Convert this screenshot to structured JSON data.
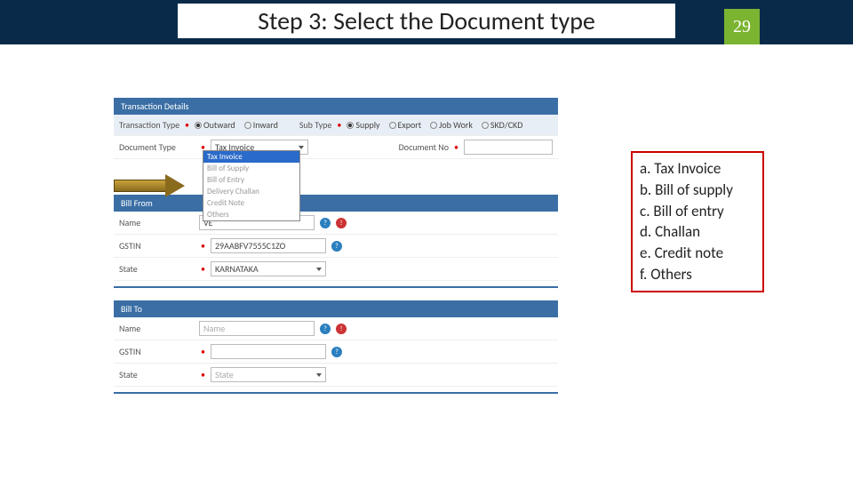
{
  "slide": {
    "title": "Step 3: Select the Document type",
    "number": "29"
  },
  "form": {
    "section_trans": "Transaction Details",
    "trans_type_label": "Transaction Type",
    "outward": "Outward",
    "inward": "Inward",
    "sub_type_label": "Sub Type",
    "supply": "Supply",
    "export": "Export",
    "jobwork": "Job Work",
    "skd": "SKD/CKD",
    "doc_type_label": "Document Type",
    "doc_type_value": "Tax Invoice",
    "doc_no_label": "Document No",
    "dropdown": {
      "o1": "Tax Invoice",
      "o2": "Bill of Supply",
      "o3": "Bill of Entry",
      "o4": "Delivery Challan",
      "o5": "Credit Note",
      "o6": "Others"
    },
    "section_from": "Bill From",
    "section_to": "Bill To",
    "name_label": "Name",
    "name_from_value": "VE",
    "gstin_label": "GSTIN",
    "gstin_from_value": "29AABFV7555C1ZO",
    "state_label": "State",
    "state_from_value": "KARNATAKA",
    "name_placeholder": "Name",
    "state_placeholder": "State"
  },
  "legend": {
    "a": "a. Tax Invoice",
    "b": "b. Bill of supply",
    "c": "c. Bill of entry",
    "d": "d. Challan",
    "e": "e. Credit note",
    "f": "f. Others"
  }
}
